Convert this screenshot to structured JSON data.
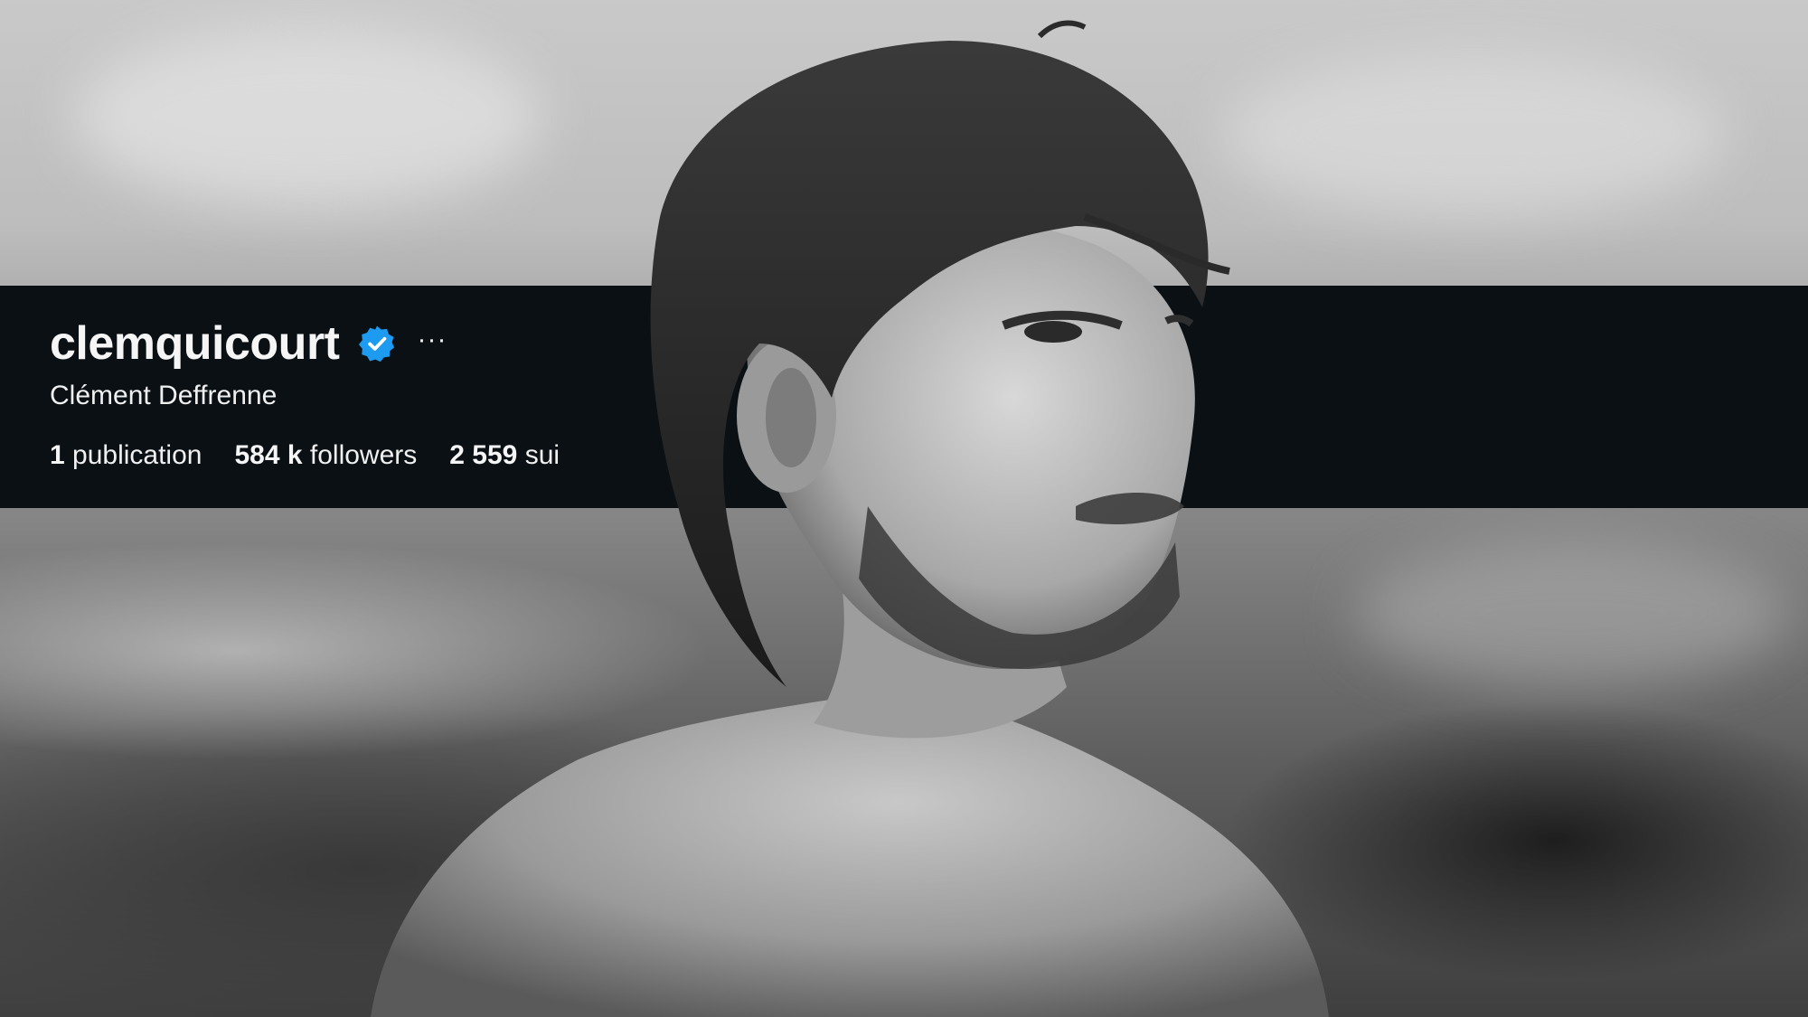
{
  "profile": {
    "username": "clemquicourt",
    "full_name": "Clément Deffrenne",
    "verified_icon": "verified-badge-icon",
    "more_icon": "more-options-icon",
    "more_label": "···",
    "stats": [
      {
        "value": "1",
        "label": "publication"
      },
      {
        "value": "584 k",
        "label": "followers"
      },
      {
        "value": "2 559",
        "label": "sui"
      }
    ]
  },
  "colors": {
    "header_background": "#0a1014",
    "verified_blue": "#1d9bf0",
    "text": "#f5f5f5"
  }
}
